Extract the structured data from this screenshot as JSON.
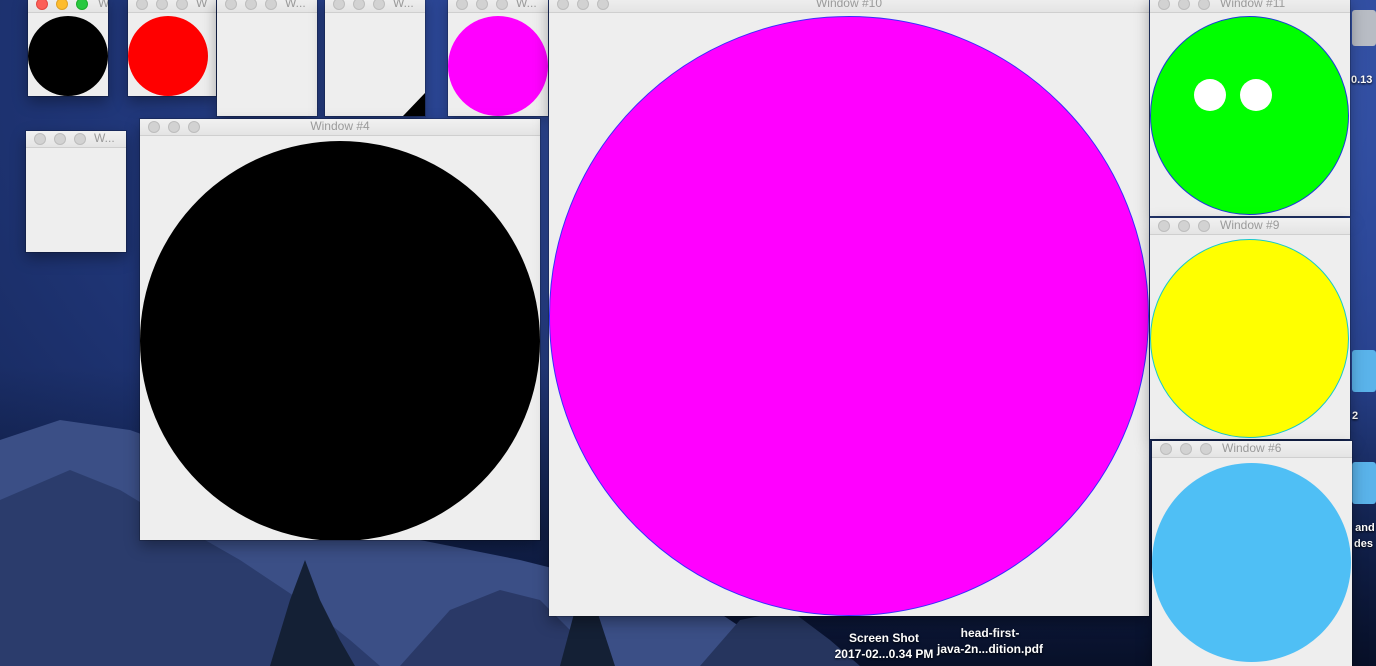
{
  "desktop": {
    "icons": [
      {
        "name": "screenshot",
        "line1": "Screen Shot",
        "line2": "2017-02...0.34 PM"
      },
      {
        "name": "pdf",
        "line1": "head-first-",
        "line2": "java-2n...dition.pdf"
      }
    ],
    "edge_texts": [
      "0.13",
      "2",
      "s and",
      "des"
    ]
  },
  "windows": {
    "w_tiny_a": {
      "title": "W"
    },
    "w_tiny_b": {
      "title": "W"
    },
    "w_tiny_c": {
      "title": "W..."
    },
    "w_tiny_d": {
      "title": "W..."
    },
    "w_tiny_e": {
      "title": "W..."
    },
    "w_tiny_f": {
      "title": "W..."
    },
    "w4": {
      "title": "Window #4"
    },
    "w10": {
      "title": "Window #10"
    },
    "w11": {
      "title": "Window #11"
    },
    "w9": {
      "title": "Window #9"
    },
    "w6": {
      "title": "Window #6"
    }
  },
  "colors": {
    "black": "#000000",
    "red": "#ff0000",
    "magenta": "#ff00ff",
    "green": "#00ff00",
    "yellow": "#ffff00",
    "sky": "#4fbff5",
    "white": "#ffffff"
  }
}
